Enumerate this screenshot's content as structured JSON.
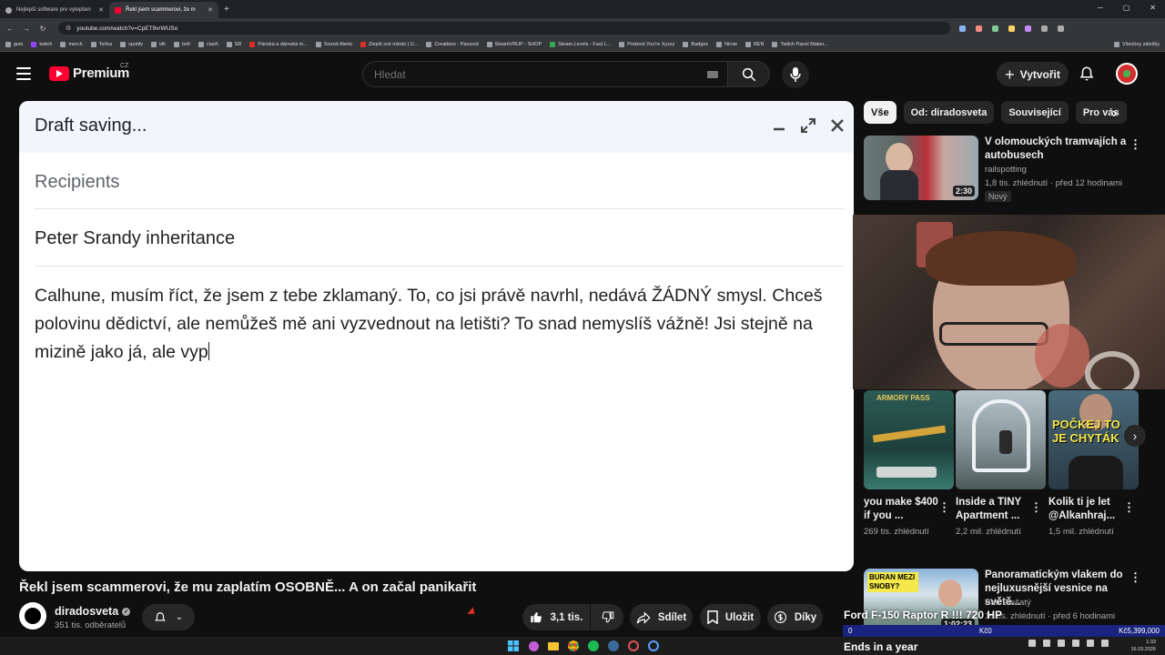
{
  "browser": {
    "tabs": [
      {
        "label": "Nejlepší software pro vylepšen",
        "active": false
      },
      {
        "label": "Řekl jsem scammerovi, že m",
        "active": true
      }
    ],
    "url": "youtube.com/watch?v=CpET9vrWUSo",
    "bookmarks": [
      "gsm",
      "twitch",
      "merch",
      "Tečka",
      "spotify",
      "idk",
      "bolt",
      "clash",
      "SR",
      "Pánská a dámská m...",
      "Sound Alerts",
      "Zlepši své město | U...",
      "Creations - Panzoid",
      "SteamVRUP - SHOP",
      "Steam.Levels - Fast L...",
      "Pretend You're Xyzzy",
      "Badges",
      "Nirvie",
      "BEN",
      "Twitch Panel Maker...",
      "Všechny záložky"
    ]
  },
  "header": {
    "logo_text": "Premium",
    "logo_region": "CZ",
    "search_placeholder": "Hledat",
    "create_label": "Vytvořit"
  },
  "draft": {
    "title": "Draft saving...",
    "recipients_placeholder": "Recipients",
    "subject": "Peter Srandy inheritance",
    "body": "Calhune, musím říct, že jsem z tebe zklamaný. To, co jsi právě navrhl, nedává ŽÁDNÝ smysl. Chceš polovinu dědictví, ale nemůžeš mě ani vyzvednout na letišti? To snad nemyslíš vážně! Jsi stejně na mizině jako já, ale vyp"
  },
  "video": {
    "title": "Řekl jsem scammerovi, že mu zaplatím OSOBNĚ... A on začal panikařit",
    "channel": "diradosveta",
    "subscribers": "351 tis. odběratelů",
    "likes": "3,1 tis.",
    "share_label": "Sdílet",
    "save_label": "Uložit",
    "thanks_label": "Díky"
  },
  "sidebar": {
    "chips": [
      "Vše",
      "Od: diradosveta",
      "Související",
      "Pro vás"
    ],
    "recommendations": [
      {
        "title": "V olomouckých tramvajích a autobusech",
        "channel": "railspotting",
        "meta": "1,8 tis. zhlédnutí · před 12 hodinami",
        "duration": "2:30",
        "badge": "Nový"
      },
      {
        "title": "Panoramatickým vlakem do nejluxusnější vesnice na světě...",
        "channel": "Pan Plešatý",
        "meta": "10 tis. zhlédnutí · před 6 hodinami",
        "duration": "1:02:23"
      }
    ],
    "shorts": [
      {
        "title": "you make $400 if you ...",
        "views": "269 tis. zhlédnutí",
        "thumb_text": "ARMORY PASS"
      },
      {
        "title": "Inside a TINY Apartment ...",
        "views": "2,2 mil. zhlédnutí",
        "thumb_text": ""
      },
      {
        "title": "Kolik ti je let @Alkanhraj...",
        "views": "1,5 mil. zhlédnutí",
        "thumb_text": "POČKEJ TO JE CHYTÁK"
      }
    ],
    "thumb2_text": "BURAN MEZI SNOBY?"
  },
  "overlay": {
    "promo": "Ford F-150 Raptor R !!! 720 HP",
    "ticker_left": "0",
    "ticker_mid": "Kč0",
    "ticker_right": "Kč5,399,000",
    "ends": "Ends in a year"
  },
  "taskbar": {
    "time": "1:33",
    "date": "16.03.2026"
  }
}
